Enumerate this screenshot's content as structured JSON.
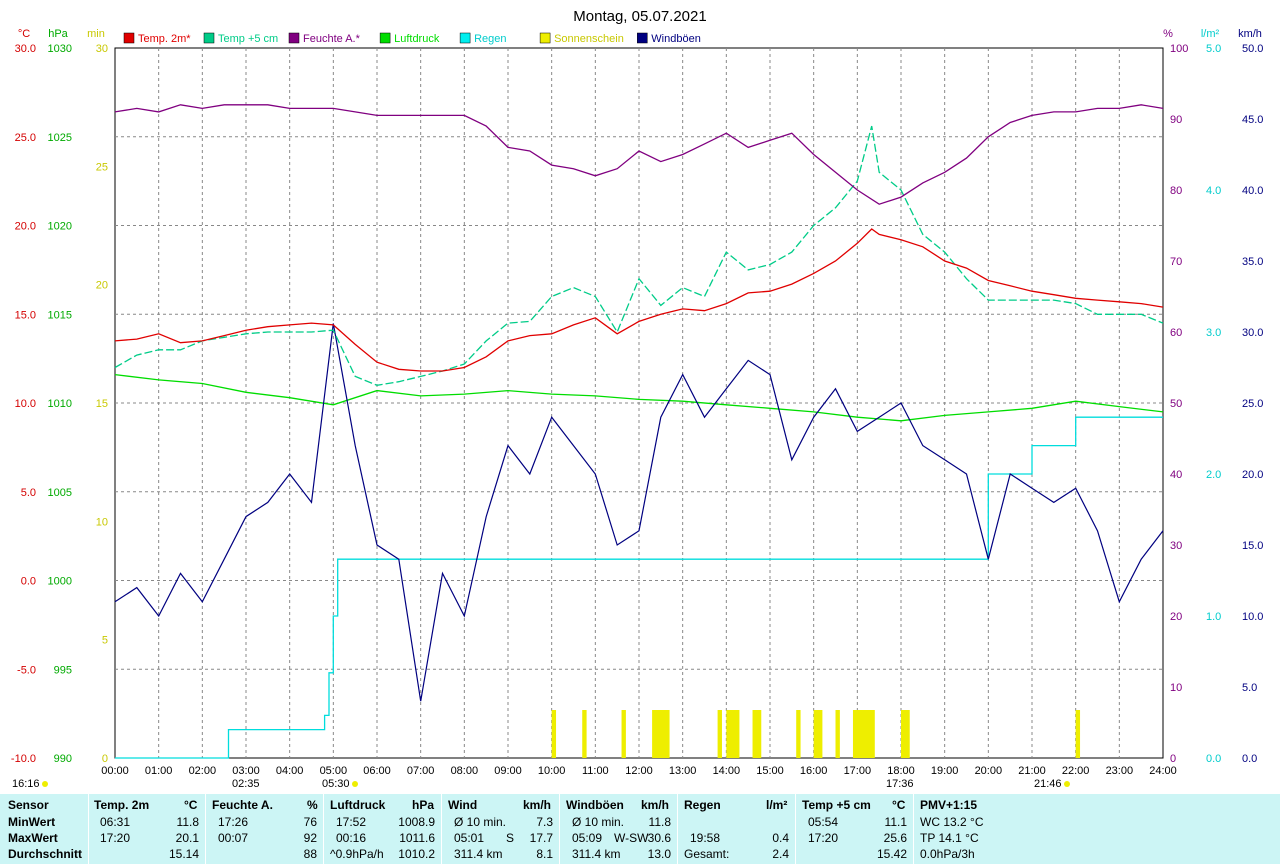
{
  "chart_data": {
    "type": "line",
    "title": "Montag, 05.07.2021",
    "x": {
      "range": [
        0,
        24
      ],
      "ticks": [
        "00:00",
        "01:00",
        "02:00",
        "03:00",
        "04:00",
        "05:00",
        "06:00",
        "07:00",
        "08:00",
        "09:00",
        "10:00",
        "11:00",
        "12:00",
        "13:00",
        "14:00",
        "15:00",
        "16:00",
        "17:00",
        "18:00",
        "19:00",
        "20:00",
        "21:00",
        "22:00",
        "23:00",
        "24:00"
      ]
    },
    "axes": {
      "temp_c": {
        "label": "°C",
        "range": [
          -10,
          30
        ],
        "ticks": [
          "30.0",
          "25.0",
          "20.0",
          "15.0",
          "10.0",
          "5.0",
          "0.0",
          "-5.0",
          "-10.0"
        ],
        "color": "#d40000"
      },
      "pressure_hpa": {
        "label": "hPa",
        "range": [
          990,
          1030
        ],
        "ticks": [
          "1030",
          "1025",
          "1020",
          "1015",
          "1010",
          "1005",
          "1000",
          "995",
          "990"
        ],
        "color": "#00aa00"
      },
      "sun_min": {
        "label": "min",
        "range": [
          0,
          30
        ],
        "ticks": [
          "30",
          "25",
          "20",
          "15",
          "10",
          "5",
          "0"
        ],
        "color": "#c8c800"
      },
      "humidity_pct": {
        "label": "%",
        "range": [
          0,
          100
        ],
        "ticks": [
          "100",
          "90",
          "80",
          "70",
          "60",
          "50",
          "40",
          "30",
          "20",
          "10",
          "0"
        ],
        "color": "#800080"
      },
      "rain_lm2": {
        "label": "l/m²",
        "range": [
          0,
          5
        ],
        "ticks": [
          "5.0",
          "4.0",
          "3.0",
          "2.0",
          "1.0",
          "0.0"
        ],
        "color": "#00cccc"
      },
      "wind_kmh": {
        "label": "km/h",
        "range": [
          0,
          50
        ],
        "ticks": [
          "50.0",
          "45.0",
          "40.0",
          "35.0",
          "30.0",
          "25.0",
          "20.0",
          "15.0",
          "10.0",
          "5.0",
          "0.0"
        ],
        "color": "#000080"
      }
    },
    "legend": [
      {
        "name": "Temp. 2m*",
        "color": "#e00000"
      },
      {
        "name": "Temp +5 cm",
        "color": "#00cc88"
      },
      {
        "name": "Feuchte A.*",
        "color": "#800080"
      },
      {
        "name": "Luftdruck",
        "color": "#00dd00"
      },
      {
        "name": "Regen",
        "color": "#00eeee"
      },
      {
        "name": "Sonnenschein",
        "color": "#eeee00"
      },
      {
        "name": "Windböen",
        "color": "#000080"
      }
    ],
    "series": [
      {
        "name": "Temp. 2m*",
        "axis": "temp_c",
        "color": "#e00000",
        "x": [
          0,
          0.5,
          1,
          1.5,
          2,
          2.5,
          3,
          3.5,
          4,
          4.5,
          5,
          5.5,
          6,
          6.5,
          7,
          7.5,
          8,
          8.5,
          9,
          9.5,
          10,
          10.5,
          11,
          11.5,
          12,
          12.5,
          13,
          13.5,
          14,
          14.5,
          15,
          15.5,
          16,
          16.5,
          17,
          17.33,
          17.5,
          18,
          18.5,
          19,
          19.5,
          20,
          20.5,
          21,
          21.5,
          22,
          22.5,
          23,
          23.5,
          24
        ],
        "y": [
          13.5,
          13.6,
          13.9,
          13.4,
          13.5,
          13.8,
          14.1,
          14.3,
          14.4,
          14.5,
          14.4,
          13.3,
          12.3,
          11.9,
          11.8,
          11.8,
          12.0,
          12.6,
          13.5,
          13.8,
          13.9,
          14.4,
          14.8,
          13.9,
          14.6,
          15.0,
          15.3,
          15.2,
          15.6,
          16.2,
          16.3,
          16.7,
          17.3,
          18.0,
          19.0,
          19.8,
          19.5,
          19.2,
          18.8,
          18.0,
          17.6,
          16.9,
          16.6,
          16.3,
          16.1,
          15.9,
          15.8,
          15.7,
          15.6,
          15.4
        ]
      },
      {
        "name": "Temp +5 cm",
        "axis": "temp_c",
        "color": "#00cc88",
        "x": [
          0,
          0.5,
          1,
          1.5,
          2,
          2.5,
          3,
          3.5,
          4,
          4.5,
          5,
          5.5,
          6,
          6.5,
          7,
          7.5,
          8,
          8.5,
          9,
          9.5,
          10,
          10.5,
          11,
          11.5,
          12,
          12.5,
          13,
          13.5,
          14,
          14.5,
          15,
          15.5,
          16,
          16.5,
          17,
          17.33,
          17.5,
          18,
          18.5,
          19,
          19.5,
          20,
          20.5,
          21,
          21.5,
          22,
          22.5,
          23,
          23.5,
          24
        ],
        "y": [
          12.0,
          12.7,
          13.0,
          13.0,
          13.5,
          13.7,
          13.9,
          14.0,
          14.0,
          14.0,
          14.1,
          11.5,
          11.0,
          11.2,
          11.5,
          11.8,
          12.2,
          13.5,
          14.5,
          14.6,
          16.0,
          16.5,
          16.0,
          14.0,
          17.0,
          15.5,
          16.5,
          16.0,
          18.5,
          17.5,
          17.8,
          18.5,
          20.0,
          21.0,
          22.5,
          25.6,
          23.0,
          22.0,
          19.5,
          18.5,
          17.0,
          15.8,
          15.8,
          15.8,
          15.8,
          15.6,
          15.0,
          15.0,
          15.0,
          14.5
        ]
      },
      {
        "name": "Feuchte A.*",
        "axis": "humidity_pct",
        "color": "#800080",
        "x": [
          0,
          0.5,
          1,
          1.5,
          2,
          2.5,
          3,
          3.5,
          4,
          4.5,
          5,
          5.5,
          6,
          6.5,
          7,
          7.5,
          8,
          8.5,
          9,
          9.5,
          10,
          10.5,
          11,
          11.5,
          12,
          12.5,
          13,
          13.5,
          14,
          14.5,
          15,
          15.5,
          16,
          16.5,
          17,
          17.5,
          18,
          18.5,
          19,
          19.5,
          20,
          20.5,
          21,
          21.5,
          22,
          22.5,
          23,
          23.5,
          24
        ],
        "y": [
          91.0,
          91.5,
          91.0,
          92.0,
          91.5,
          92.0,
          92.0,
          92.0,
          91.5,
          91.5,
          91.5,
          91.0,
          90.5,
          90.5,
          90.5,
          90.5,
          90.5,
          89.0,
          86.0,
          85.5,
          83.5,
          83.0,
          82.0,
          83.0,
          85.5,
          84.0,
          85.0,
          86.5,
          88.0,
          86.0,
          87.0,
          88.0,
          85.0,
          82.5,
          80.0,
          78.0,
          79.0,
          81.0,
          82.5,
          84.5,
          87.5,
          89.5,
          90.5,
          91.0,
          91.0,
          91.5,
          91.5,
          92.0,
          91.5
        ]
      },
      {
        "name": "Luftdruck",
        "axis": "pressure_hpa",
        "color": "#00dd00",
        "x": [
          0,
          1,
          2,
          3,
          4,
          5,
          6,
          7,
          8,
          9,
          10,
          11,
          12,
          13,
          14,
          15,
          16,
          17,
          18,
          19,
          20,
          21,
          22,
          23,
          24
        ],
        "y": [
          1011.6,
          1011.3,
          1011.1,
          1010.6,
          1010.3,
          1009.9,
          1010.7,
          1010.4,
          1010.5,
          1010.7,
          1010.5,
          1010.4,
          1010.2,
          1010.1,
          1009.9,
          1009.7,
          1009.5,
          1009.2,
          1009.0,
          1009.3,
          1009.5,
          1009.7,
          1010.1,
          1009.8,
          1009.5
        ]
      },
      {
        "name": "Regen",
        "axis": "rain_lm2",
        "color": "#00dddd",
        "x": [
          0,
          2.6,
          2.6,
          4.7,
          4.8,
          4.9,
          5.0,
          5.1,
          10.0,
          20.0,
          20.0,
          21.0,
          21.0,
          22.0,
          22.0,
          24.0
        ],
        "y": [
          0,
          0,
          0.2,
          0.2,
          0.3,
          0.6,
          1.0,
          1.4,
          1.4,
          1.4,
          2.0,
          2.0,
          2.2,
          2.2,
          2.4,
          2.4
        ]
      },
      {
        "name": "Windböen",
        "axis": "wind_kmh",
        "color": "#000080",
        "x": [
          0,
          0.5,
          1,
          1.5,
          2,
          2.5,
          3,
          3.5,
          4,
          4.5,
          5,
          5.5,
          6,
          6.5,
          7,
          7.5,
          8,
          8.5,
          9,
          9.5,
          10,
          10.5,
          11,
          11.5,
          12,
          12.5,
          13,
          13.5,
          14,
          14.5,
          15,
          15.5,
          16,
          16.5,
          17,
          17.5,
          18,
          18.5,
          19,
          19.5,
          20,
          20.5,
          21,
          21.5,
          22,
          22.5,
          23,
          23.5,
          24
        ],
        "y": [
          11,
          12,
          10,
          13,
          11,
          14,
          17,
          18,
          20,
          18,
          30.6,
          22,
          15,
          14,
          4,
          13,
          10,
          17,
          22,
          20,
          24,
          22,
          20,
          15,
          16,
          24,
          27,
          24,
          26,
          28,
          27,
          21,
          24,
          26,
          23,
          24,
          25,
          22,
          21,
          20,
          14,
          20,
          19,
          18,
          19,
          16,
          11,
          14,
          16
        ]
      }
    ],
    "sunshine_blocks_h": [
      [
        10.0,
        10.1
      ],
      [
        10.7,
        10.8
      ],
      [
        11.6,
        11.7
      ],
      [
        12.3,
        12.7
      ],
      [
        13.8,
        13.9
      ],
      [
        14.0,
        14.3
      ],
      [
        14.6,
        14.8
      ],
      [
        15.6,
        15.7
      ],
      [
        16.0,
        16.2
      ],
      [
        16.5,
        16.6
      ],
      [
        16.9,
        17.4
      ],
      [
        18.0,
        18.2
      ],
      [
        22.0,
        22.1
      ]
    ],
    "markers": {
      "sunrise": "02:35",
      "sunset_ref": "16:16",
      "sun_noon_a": "05:30",
      "sun_noon_b": "17:36",
      "dusk": "21:46"
    }
  },
  "summary": {
    "row_labels": [
      "Sensor",
      "MinWert",
      "MaxWert",
      "Durchschnitt"
    ],
    "temp2m": {
      "title": "Temp. 2m",
      "unit": "°C",
      "min_time": "06:31",
      "min": "11.8",
      "max_time": "17:20",
      "max": "20.1",
      "avg": "15.14"
    },
    "humidity": {
      "title": "Feuchte A.",
      "unit": "%",
      "min_time": "17:26",
      "min": "76",
      "max_time": "00:07",
      "max": "92",
      "avg": "88"
    },
    "pressure": {
      "title": "Luftdruck",
      "unit": "hPa",
      "min_time": "17:52",
      "min": "1008.9",
      "max_time": "00:16",
      "max": "1011.6",
      "avg_label": "^0.9hPa/h",
      "avg": "1010.2"
    },
    "wind": {
      "title": "Wind",
      "unit": "km/h",
      "min_label": "Ø 10 min.",
      "min": "7.3",
      "max_time": "05:01",
      "max_dir": "S",
      "max": "17.7",
      "avg_label": "311.4 km",
      "avg": "8.1"
    },
    "gusts": {
      "title": "Windböen",
      "unit": "km/h",
      "min_label": "Ø 10 min.",
      "min": "11.8",
      "max_time": "05:09",
      "max_dir": "W-SW",
      "max": "30.6",
      "avg_label": "311.4 km",
      "avg": "13.0"
    },
    "rain": {
      "title": "Regen",
      "unit": "l/m²",
      "max_time": "19:58",
      "max": "0.4",
      "avg_label": "Gesamt:",
      "avg": "2.4"
    },
    "temp5cm": {
      "title": "Temp +5 cm",
      "unit": "°C",
      "min_time": "05:54",
      "min": "11.1",
      "max_time": "17:20",
      "max": "25.6",
      "avg": "15.42"
    },
    "pmv": {
      "title": "PMV+1:15",
      "row1": "WC 13.2 °C",
      "row2": "TP 14.1 °C",
      "row3": "0.0hPa/3h"
    }
  }
}
